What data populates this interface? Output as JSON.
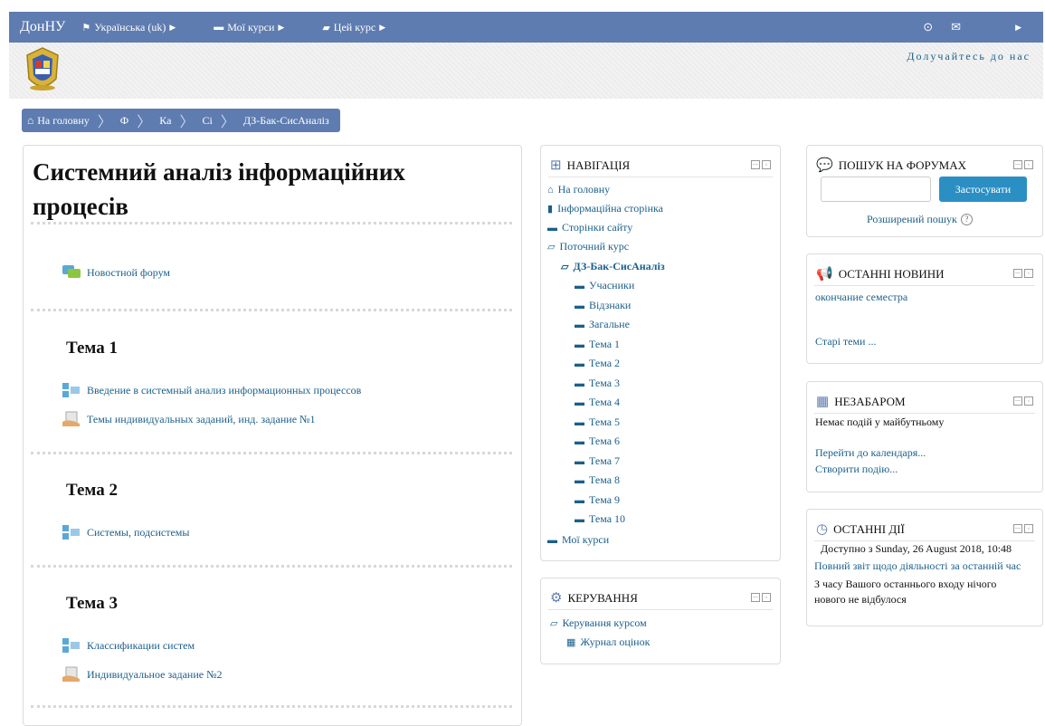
{
  "navbar": {
    "brand": "ДонНУ",
    "lang": "Українська (uk)",
    "my_courses": "Мої курси",
    "this_course": "Цей курс"
  },
  "header": {
    "join": "Долучайтесь до нас"
  },
  "breadcrumb": [
    "На головну",
    "Ф",
    "Ка",
    "Сі",
    "ДЗ-Бак-СисАналіз"
  ],
  "course": {
    "title": "Системний аналіз інформаційних процесів",
    "forum": "Новостной форум",
    "topics": [
      {
        "title": "Тема 1",
        "items": [
          "Введение в системный анализ информационных процессов",
          "Темы индивидуальных заданий, инд. задание №1"
        ]
      },
      {
        "title": "Тема 2",
        "items": [
          "Системы, подсистемы"
        ]
      },
      {
        "title": "Тема 3",
        "items": [
          "Классификации систем",
          "Индивидуальное задание №2"
        ]
      }
    ]
  },
  "navigation": {
    "title": "НАВІГАЦІЯ",
    "home": "На головну",
    "info_page": "Інформаційна сторінка",
    "site_pages": "Сторінки сайту",
    "current_course": "Поточний курс",
    "course_name": "ДЗ-Бак-СисАналіз",
    "sub_items": [
      "Учасники",
      "Відзнаки",
      "Загальне",
      "Тема 1",
      "Тема 2",
      "Тема 3",
      "Тема 4",
      "Тема 5",
      "Тема 6",
      "Тема 7",
      "Тема 8",
      "Тема 9",
      "Тема 10"
    ],
    "my_courses": "Мої курси"
  },
  "admin": {
    "title": "КЕРУВАННЯ",
    "course_admin": "Керування курсом",
    "gradebook": "Журнал оцінок"
  },
  "search_forums": {
    "title": "ПОШУК НА ФОРУМАХ",
    "button": "Застосувати",
    "advanced": "Розширений пошук"
  },
  "news": {
    "title": "ОСТАННІ НОВИНИ",
    "item": "окончание семестра",
    "older": "Старі теми ..."
  },
  "upcoming": {
    "title": "НЕЗАБАРОМ",
    "none": "Немає подій у майбутньому",
    "calendar": "Перейти до календаря...",
    "new_event": "Створити подію..."
  },
  "recent": {
    "title": "ОСТАННІ ДІЇ",
    "since": "Доступно з Sunday, 26 August 2018, 10:48",
    "full_report": "Повний звіт щодо діяльності за останній час",
    "nothing_line1": "З часу Вашого останнього входу нічого",
    "nothing_line2": "нового не відбулося"
  }
}
